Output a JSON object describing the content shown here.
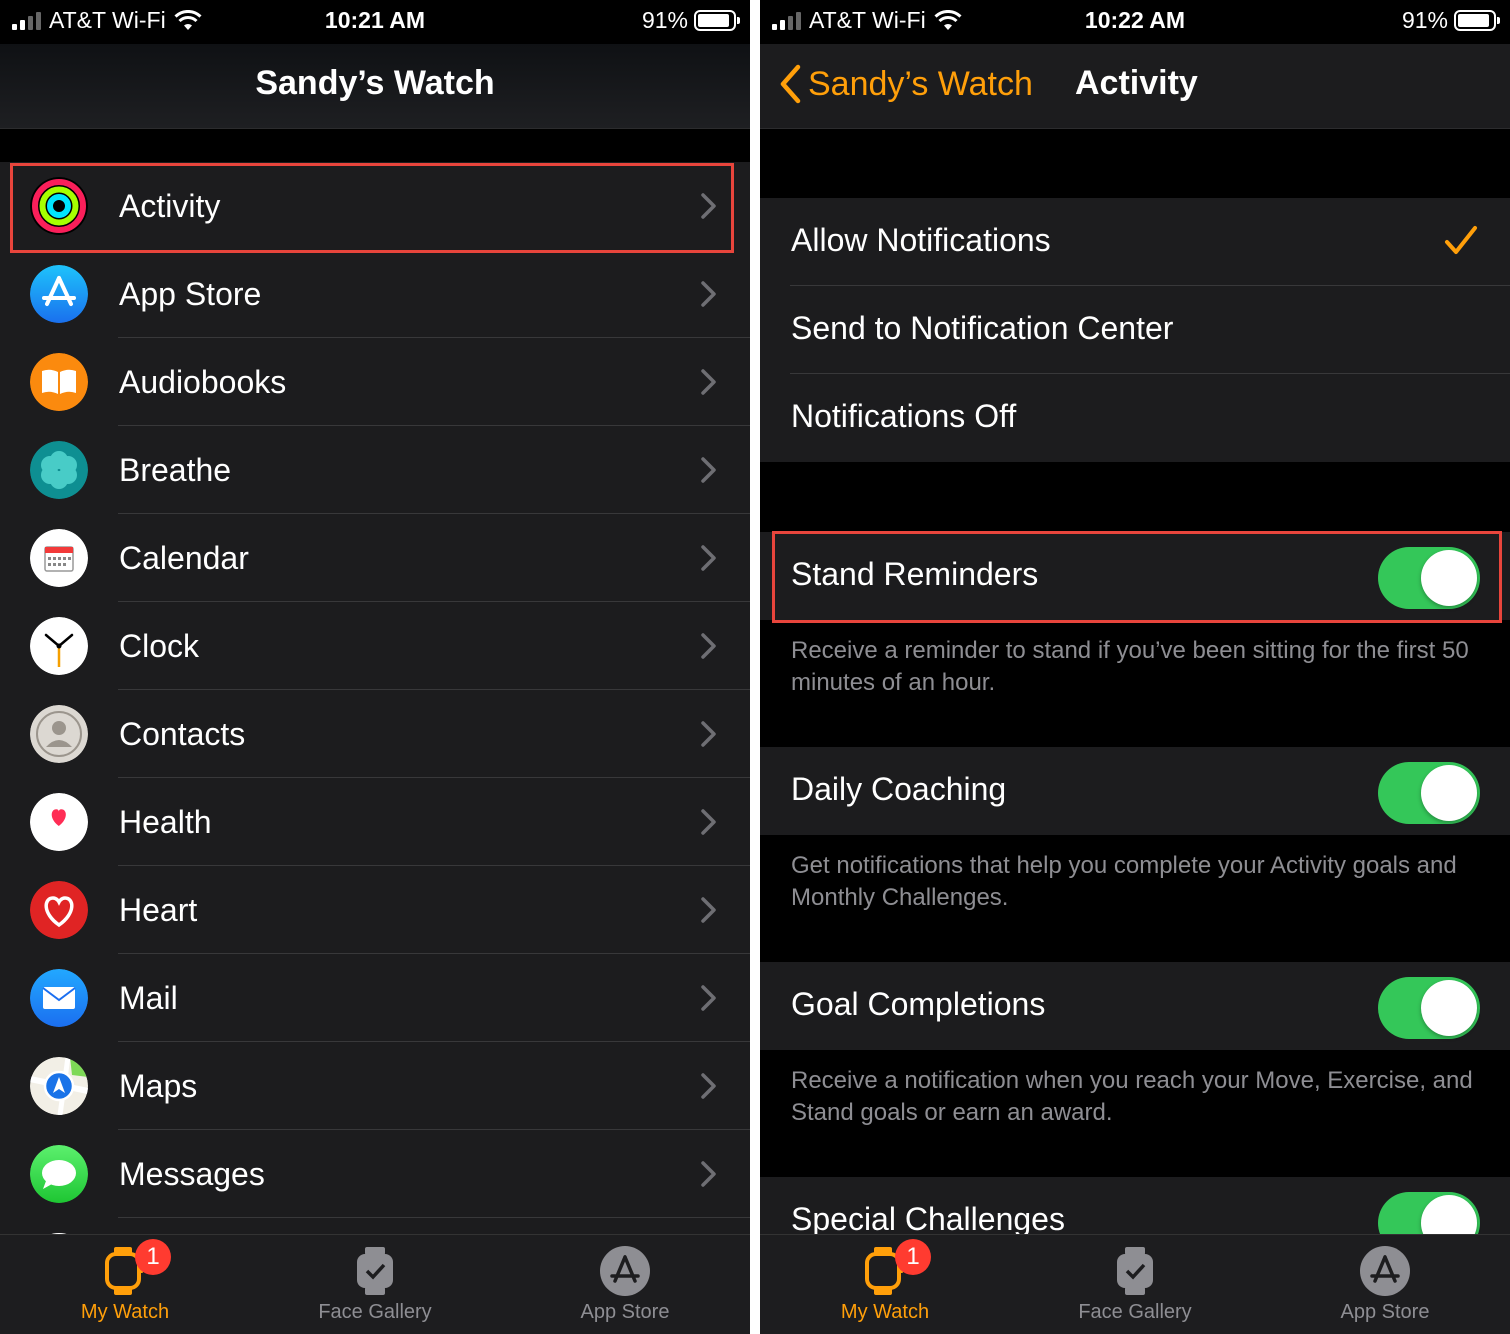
{
  "left": {
    "status": {
      "carrier": "AT&T Wi-Fi",
      "time": "10:21 AM",
      "battery": "91%"
    },
    "title": "Sandy’s Watch",
    "items": [
      {
        "label": "Activity",
        "icon": "activity-rings-icon"
      },
      {
        "label": "App Store",
        "icon": "app-store-icon"
      },
      {
        "label": "Audiobooks",
        "icon": "audiobooks-icon"
      },
      {
        "label": "Breathe",
        "icon": "breathe-icon"
      },
      {
        "label": "Calendar",
        "icon": "calendar-icon"
      },
      {
        "label": "Clock",
        "icon": "clock-icon"
      },
      {
        "label": "Contacts",
        "icon": "contacts-icon"
      },
      {
        "label": "Health",
        "icon": "health-heart-icon"
      },
      {
        "label": "Heart",
        "icon": "heart-icon"
      },
      {
        "label": "Mail",
        "icon": "mail-envelope-icon"
      },
      {
        "label": "Maps",
        "icon": "maps-icon"
      },
      {
        "label": "Messages",
        "icon": "messages-bubble-icon"
      }
    ],
    "tabs": [
      {
        "label": "My Watch",
        "badge": "1",
        "active": true
      },
      {
        "label": "Face Gallery"
      },
      {
        "label": "App Store"
      }
    ]
  },
  "right": {
    "status": {
      "carrier": "AT&T Wi-Fi",
      "time": "10:22 AM",
      "battery": "91%"
    },
    "back_label": "Sandy’s Watch",
    "title": "Activity",
    "notifications": [
      {
        "label": "Allow Notifications",
        "checked": true
      },
      {
        "label": "Send to Notification Center"
      },
      {
        "label": "Notifications Off"
      }
    ],
    "stand_reminders": {
      "label": "Stand Reminders",
      "on": true,
      "footnote": "Receive a reminder to stand if you’ve been sitting for the first 50 minutes of an hour."
    },
    "daily_coaching": {
      "label": "Daily Coaching",
      "on": true,
      "footnote": "Get notifications that help you complete your Activity goals and Monthly Challenges."
    },
    "goal_completions": {
      "label": "Goal Completions",
      "on": true,
      "footnote": "Receive a notification when you reach your Move, Exercise, and Stand goals or earn an award."
    },
    "special_challenges": {
      "label": "Special Challenges",
      "on": true
    },
    "tabs": [
      {
        "label": "My Watch",
        "badge": "1",
        "active": true
      },
      {
        "label": "Face Gallery"
      },
      {
        "label": "App Store"
      }
    ]
  },
  "colors": {
    "accent": "#ff9f0a",
    "toggle_on": "#34c759",
    "highlight": "#e8453c",
    "badge": "#ff3b30"
  }
}
